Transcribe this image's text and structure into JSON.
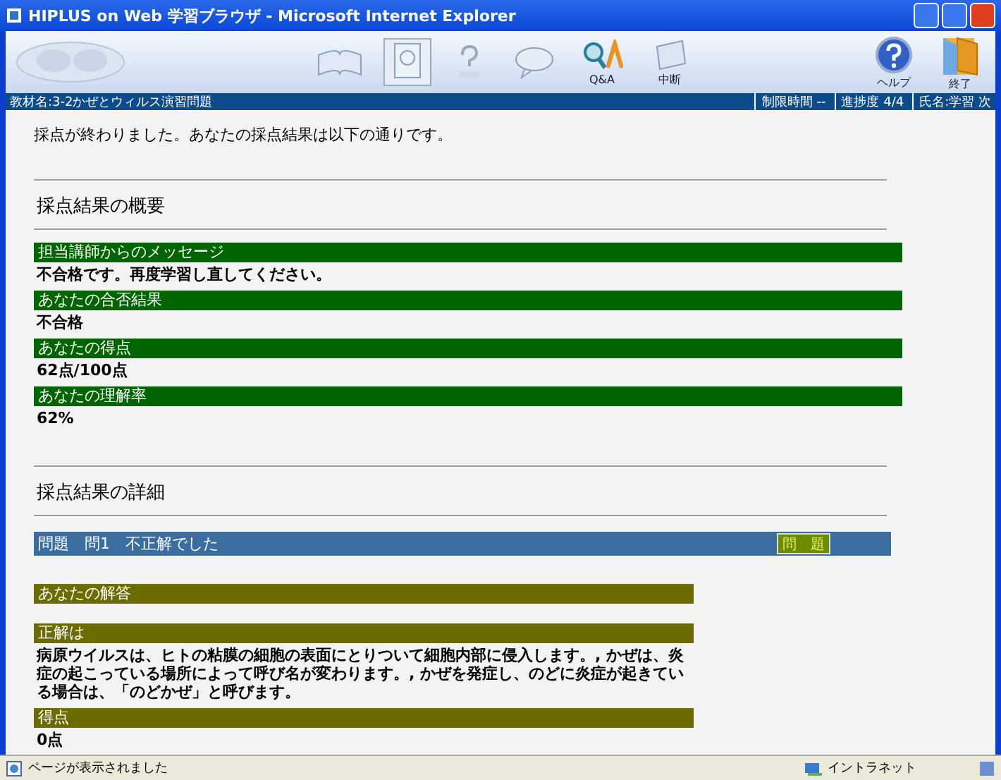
{
  "window": {
    "title": "HIPLUS on Web 学習ブラウザ - Microsoft Internet Explorer"
  },
  "toolbar": [
    {
      "kind": "book",
      "selected": false
    },
    {
      "kind": "page",
      "selected": true
    },
    {
      "kind": "question",
      "selected": false
    },
    {
      "kind": "chat",
      "selected": false
    },
    {
      "kind": "qa",
      "label": "Q&A",
      "selected": false
    },
    {
      "kind": "tablet",
      "label": "中断",
      "selected": false
    }
  ],
  "toolbar_right": [
    {
      "kind": "help",
      "label": "ヘルプ"
    },
    {
      "kind": "exit",
      "label": "終了"
    }
  ],
  "info_bar": {
    "material": "教材名:3-2かぜとウィルス演習問題",
    "time_limit": "制限時間 --",
    "progress": "進捗度 4/4",
    "name": "氏名:学習 次"
  },
  "intro": "採点が終わりました。あなたの採点結果は以下の通りです。",
  "summary": {
    "heading": "採点結果の概要",
    "items": [
      {
        "label": "担当講師からのメッセージ",
        "value": "不合格です。再度学習し直してください。"
      },
      {
        "label": "あなたの合否結果",
        "value": "不合格"
      },
      {
        "label": "あなたの得点",
        "value": "62点/100点"
      },
      {
        "label": "あなたの理解率",
        "value": "62%"
      }
    ]
  },
  "details": {
    "heading": "採点結果の詳細",
    "question_bar": {
      "text": "問題　問1　不正解でした",
      "button": "問　題"
    },
    "items": [
      {
        "label": "あなたの解答"
      },
      {
        "label": "正解は",
        "value": "病原ウイルスは、ヒトの粘膜の細胞の表面にとりついて細胞内部に侵入します。, かぜは、炎症の起こっている場所によって呼び名が変わります。, かぜを発症し、のどに炎症が起きている場合は、「のどかぜ」と呼びます。"
      },
      {
        "label": "得点",
        "value": "0点"
      }
    ]
  },
  "status_bar": {
    "text": "ページが表示されました",
    "zone": "イントラネット"
  }
}
